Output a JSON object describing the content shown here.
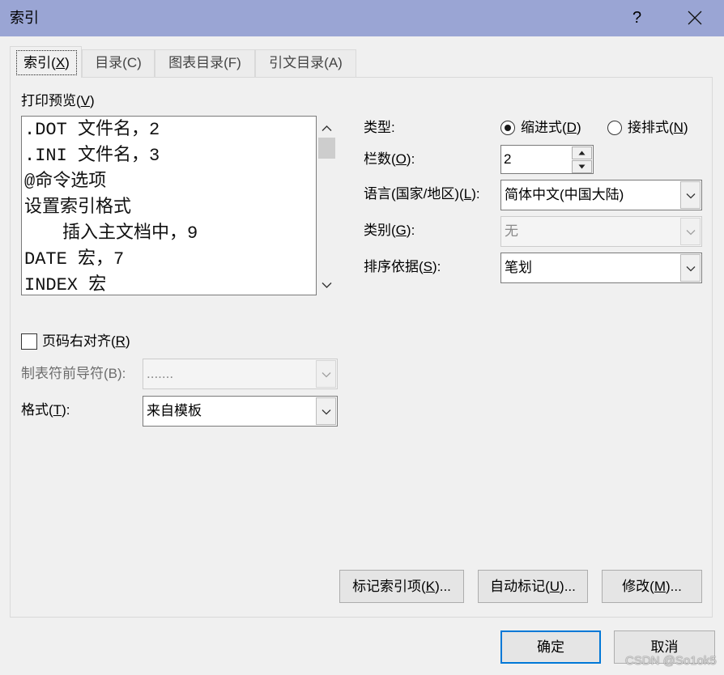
{
  "window": {
    "title": "索引",
    "help_label": "?",
    "close_icon": "close-icon"
  },
  "colors": {
    "titlebar": "#9aa5d4",
    "default_button_border": "#0078d7"
  },
  "tabs": [
    {
      "label": "索引(X)",
      "active": true
    },
    {
      "label": "目录(C)",
      "active": false
    },
    {
      "label": "图表目录(F)",
      "active": false
    },
    {
      "label": "引文目录(A)",
      "active": false
    }
  ],
  "preview": {
    "label": "打印预览(V)",
    "lines": [
      {
        "text": ".DOT 文件名，2",
        "level": 1
      },
      {
        "text": ".INI 文件名，3",
        "level": 1
      },
      {
        "text": "@命令选项",
        "level": 1
      },
      {
        "text": "设置索引格式",
        "level": 1
      },
      {
        "text": "插入主文档中，9",
        "level": 2
      },
      {
        "text": "DATE 宏，7",
        "level": 1
      },
      {
        "text": "INDEX 宏",
        "level": 1
      }
    ],
    "scroll_icons": [
      "chevron-up-icon",
      "chevron-down-icon"
    ]
  },
  "type": {
    "label": "类型:",
    "options": [
      {
        "label": "缩进式(D)",
        "selected": true
      },
      {
        "label": "接排式(N)",
        "selected": false
      }
    ]
  },
  "columns": {
    "label": "栏数(O):",
    "value": "2"
  },
  "language": {
    "label": "语言(国家/地区)(L):",
    "value": "简体中文(中国大陆)"
  },
  "category": {
    "label": "类别(G):",
    "value": "无",
    "disabled": true
  },
  "sort_by": {
    "label": "排序依据(S):",
    "value": "笔划"
  },
  "right_align": {
    "label": "页码右对齐(R)",
    "checked": false
  },
  "tab_leader": {
    "label": "制表符前导符(B):",
    "value": ".......",
    "disabled": true
  },
  "formats": {
    "label": "格式(T):",
    "value": "来自模板"
  },
  "actions": {
    "mark_entry": "标记索引项(K)...",
    "auto_mark": "自动标记(U)...",
    "modify": "修改(M)..."
  },
  "footer": {
    "ok": "确定",
    "cancel": "取消"
  },
  "watermark": "CSDN @So1ok5"
}
